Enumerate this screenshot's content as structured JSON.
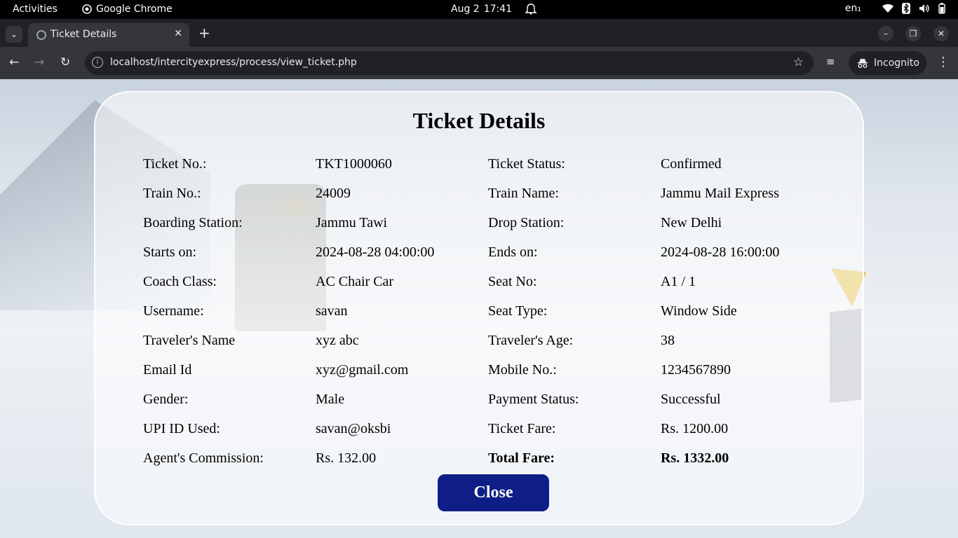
{
  "system_bar": {
    "activities": "Activities",
    "app_name": "Google Chrome",
    "date": "Aug 2",
    "time": "17:41",
    "language": "en₁"
  },
  "browser": {
    "tab_title": "Ticket Details",
    "url": "localhost/intercityexpress/process/view_ticket.php",
    "incognito_label": "Incognito"
  },
  "ticket": {
    "heading": "Ticket Details",
    "rows": [
      {
        "l1": "Ticket No.:",
        "v1": "TKT1000060",
        "l2": "Ticket Status:",
        "v2": "Confirmed"
      },
      {
        "l1": "Train No.:",
        "v1": "24009",
        "l2": "Train Name:",
        "v2": "Jammu Mail Express"
      },
      {
        "l1": "Boarding Station:",
        "v1": "Jammu Tawi",
        "l2": "Drop Station:",
        "v2": "New Delhi"
      },
      {
        "l1": "Starts on:",
        "v1": "2024-08-28 04:00:00",
        "l2": "Ends on:",
        "v2": "2024-08-28 16:00:00"
      },
      {
        "l1": "Coach Class:",
        "v1": "AC Chair Car",
        "l2": "Seat No:",
        "v2": "A1 / 1"
      },
      {
        "l1": "Username:",
        "v1": "savan",
        "l2": "Seat Type:",
        "v2": "Window Side"
      },
      {
        "l1": "Traveler's Name",
        "v1": "xyz abc",
        "l2": "Traveler's Age:",
        "v2": "38"
      },
      {
        "l1": "Email Id",
        "v1": "xyz@gmail.com",
        "l2": "Mobile No.:",
        "v2": "1234567890"
      },
      {
        "l1": "Gender:",
        "v1": "Male",
        "l2": "Payment Status:",
        "v2": "Successful"
      },
      {
        "l1": "UPI ID Used:",
        "v1": "savan@oksbi",
        "l2": "Ticket Fare:",
        "v2": "Rs. 1200.00"
      },
      {
        "l1": "Agent's Commission:",
        "v1": "Rs. 132.00",
        "l2": "Total Fare:",
        "v2": "Rs. 1332.00"
      }
    ],
    "close_label": "Close"
  },
  "colors": {
    "close_button": "#0e1e86",
    "chrome_dark": "#202124",
    "chrome_toolbar": "#35363a"
  }
}
